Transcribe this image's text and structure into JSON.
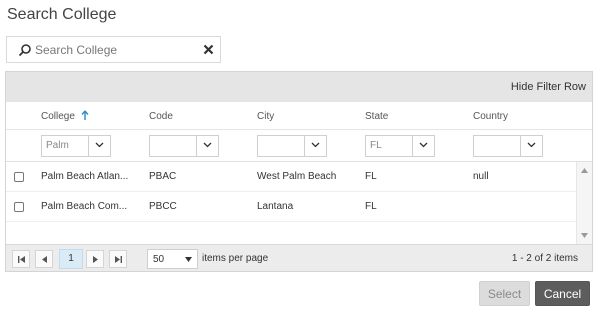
{
  "dialog": {
    "title": "Search College"
  },
  "search": {
    "placeholder": "Search College",
    "value": ""
  },
  "grid": {
    "hide_filter_label": "Hide Filter Row",
    "columns": [
      {
        "key": "college",
        "label": "College",
        "sorted": "asc"
      },
      {
        "key": "code",
        "label": "Code"
      },
      {
        "key": "city",
        "label": "City"
      },
      {
        "key": "state",
        "label": "State"
      },
      {
        "key": "country",
        "label": "Country"
      }
    ],
    "filters": {
      "college": "Palm",
      "code": "",
      "city": "",
      "state": "FL",
      "country": ""
    },
    "rows": [
      {
        "college": "Palm Beach Atlan...",
        "code": "PBAC",
        "city": "West Palm Beach",
        "state": "FL",
        "country": "null"
      },
      {
        "college": "Palm Beach Com...",
        "code": "PBCC",
        "city": "Lantana",
        "state": "FL",
        "country": ""
      }
    ]
  },
  "pager": {
    "current_page": "1",
    "page_size": "50",
    "per_page_label": "items per page",
    "range_text": "1 - 2 of 2 items"
  },
  "actions": {
    "select_label": "Select",
    "cancel_label": "Cancel"
  },
  "colors": {
    "accent": "#2d88c9",
    "toolbar_bg": "#e5e5e5",
    "cancel_bg": "#5d5d5d",
    "current_page_bg": "#d9ebf7"
  },
  "icons": {
    "search": "search-icon",
    "clear": "close-icon",
    "sort": "arrow-up-icon",
    "dropdown": "chevron-down-icon"
  }
}
